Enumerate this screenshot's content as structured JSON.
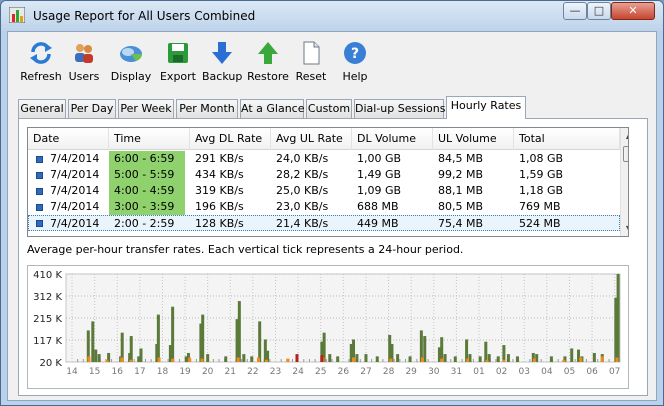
{
  "window": {
    "title": "Usage Report for All Users Combined",
    "controls": {
      "minimize": "—",
      "maximize": "□",
      "close": "✕"
    }
  },
  "toolbar": [
    {
      "label": "Refresh",
      "icon": "refresh-icon"
    },
    {
      "label": "Users",
      "icon": "users-icon"
    },
    {
      "label": "Display",
      "icon": "display-icon"
    },
    {
      "label": "Export",
      "icon": "export-icon"
    },
    {
      "label": "Backup",
      "icon": "backup-icon"
    },
    {
      "label": "Restore",
      "icon": "restore-icon"
    },
    {
      "label": "Reset",
      "icon": "reset-icon"
    },
    {
      "label": "Help",
      "icon": "help-icon"
    }
  ],
  "tabs": [
    "General",
    "Per Day",
    "Per Week",
    "Per Month",
    "At a Glance",
    "Custom",
    "Dial-up Sessions",
    "Hourly Rates"
  ],
  "active_tab": "Hourly Rates",
  "table": {
    "columns": [
      "Date",
      "Time",
      "Avg DL Rate",
      "Avg UL Rate",
      "DL Volume",
      "UL Volume",
      "Total"
    ],
    "rows": [
      [
        "7/4/2014",
        "6:00 - 6:59",
        "291 KB/s",
        "24,0 KB/s",
        "1,00 GB",
        "84,5 MB",
        "1,08 GB"
      ],
      [
        "7/4/2014",
        "5:00 - 5:59",
        "434 KB/s",
        "28,2 KB/s",
        "1,49 GB",
        "99,2 MB",
        "1,59 GB"
      ],
      [
        "7/4/2014",
        "4:00 - 4:59",
        "319 KB/s",
        "25,0 KB/s",
        "1,09 GB",
        "88,1 MB",
        "1,18 GB"
      ],
      [
        "7/4/2014",
        "3:00 - 3:59",
        "196 KB/s",
        "23,0 KB/s",
        "688 MB",
        "80,5 MB",
        "769 MB"
      ],
      [
        "7/4/2014",
        "2:00 - 2:59",
        "128 KB/s",
        "21,4 KB/s",
        "449 MB",
        "75,4 MB",
        "524 MB"
      ]
    ],
    "selected_row": 4,
    "highlighted_time_rows": [
      0,
      1,
      2,
      3
    ],
    "highlight_color": "#8fd16c",
    "scrollbar": {
      "up": "▲",
      "down": "▼"
    }
  },
  "note": "Average per-hour transfer rates. Each vertical tick represents a 24-hour period.",
  "chart_data": {
    "type": "bar",
    "y_ticks": [
      "410 K",
      "312 K",
      "215 K",
      "117 K",
      "20 K"
    ],
    "ylim": [
      20,
      410
    ],
    "x_ticks": [
      "14",
      "15",
      "16",
      "17",
      "18",
      "19",
      "20",
      "21",
      "22",
      "23",
      "24",
      "25",
      "26",
      "27",
      "28",
      "29",
      "30",
      "31",
      "01",
      "02",
      "03",
      "04",
      "05",
      "06",
      "07"
    ],
    "series": [
      {
        "color": "#5b7a3a",
        "x": [
          0.72,
          0.92,
          1.05,
          1.2,
          1.62,
          2.15,
          2.22,
          2.55,
          2.62,
          2.95,
          3.05,
          3.75,
          3.82,
          4.35,
          4.45,
          5.05,
          5.15,
          5.7,
          5.78,
          6.0,
          6.8,
          7.3,
          7.4,
          7.6,
          7.95,
          8.3,
          8.55,
          8.65,
          9.95,
          11.05,
          11.15,
          11.4,
          11.75,
          12.35,
          12.45,
          12.6,
          13.0,
          13.5,
          14.05,
          14.15,
          14.4,
          14.95,
          15.45,
          15.6,
          16.25,
          16.35,
          16.5,
          16.95,
          17.45,
          17.6,
          18.05,
          18.3,
          18.45,
          18.85,
          19.1,
          19.3,
          19.7,
          20.4,
          20.55,
          21.2,
          21.8,
          22.1,
          22.4,
          22.55,
          23.1,
          23.45,
          24.05,
          24.15
        ],
        "values": [
          160,
          200,
          75,
          55,
          60,
          45,
          150,
          60,
          135,
          45,
          80,
          100,
          230,
          95,
          265,
          45,
          60,
          190,
          230,
          55,
          45,
          210,
          290,
          55,
          45,
          200,
          120,
          70,
          45,
          110,
          150,
          55,
          45,
          100,
          120,
          55,
          55,
          45,
          140,
          100,
          55,
          45,
          160,
          135,
          85,
          130,
          55,
          45,
          120,
          55,
          45,
          110,
          55,
          45,
          95,
          55,
          45,
          60,
          55,
          45,
          45,
          80,
          75,
          45,
          60,
          55,
          305,
          410
        ]
      },
      {
        "color": "#f08a1c",
        "x": [
          0.75,
          1.55,
          2.2,
          2.6,
          3.85,
          4.45,
          5.2,
          5.75,
          7.35,
          8.25,
          8.6,
          9.55,
          11.1,
          12.45,
          14.1,
          15.5,
          16.35,
          17.5,
          18.35,
          19.1,
          20.45,
          21.75,
          22.5,
          23.45,
          24.1
        ],
        "values": [
          45,
          30,
          40,
          30,
          40,
          35,
          40,
          35,
          40,
          40,
          30,
          35,
          40,
          40,
          35,
          40,
          35,
          35,
          30,
          30,
          35,
          30,
          40,
          45,
          40
        ]
      },
      {
        "color": "#b22222",
        "x": [
          9.95,
          11.05
        ],
        "values": [
          55,
          50
        ]
      }
    ],
    "grid": true
  }
}
